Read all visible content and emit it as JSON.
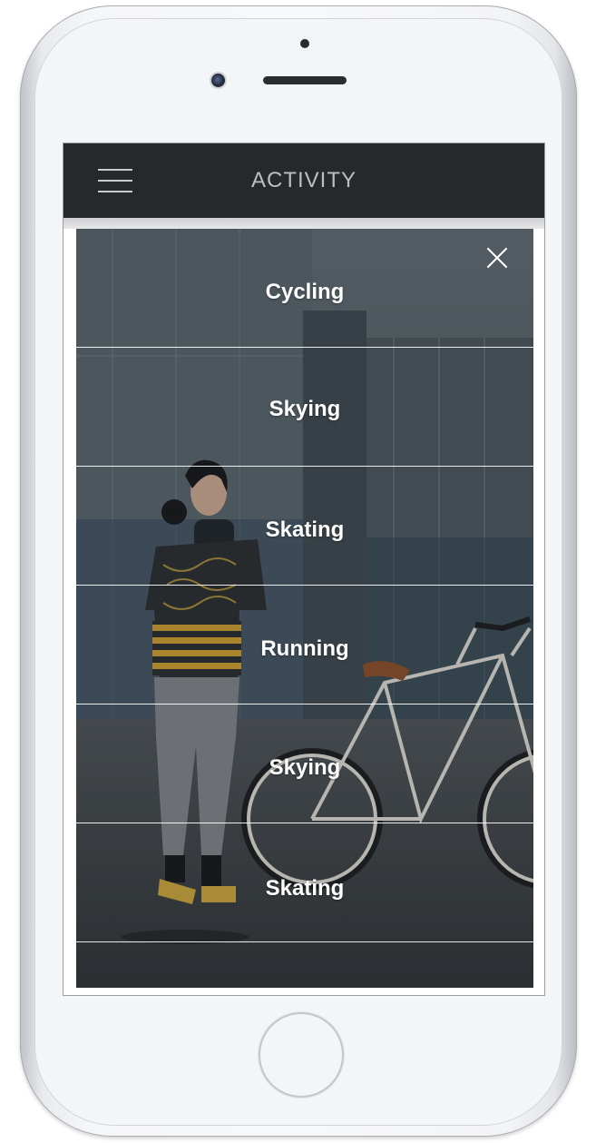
{
  "header": {
    "title": "ACTIVITY",
    "menu_icon": "hamburger-menu-icon"
  },
  "overlay": {
    "close_icon": "close-icon",
    "items": [
      {
        "label": "Cycling"
      },
      {
        "label": "Skying"
      },
      {
        "label": "Skating"
      },
      {
        "label": "Running"
      },
      {
        "label": "Skying"
      },
      {
        "label": "Skating"
      }
    ]
  },
  "colors": {
    "header_bg": "#27282b",
    "header_text": "#bdbec1",
    "menu_text": "#ffffff",
    "divider": "#ffffff"
  }
}
